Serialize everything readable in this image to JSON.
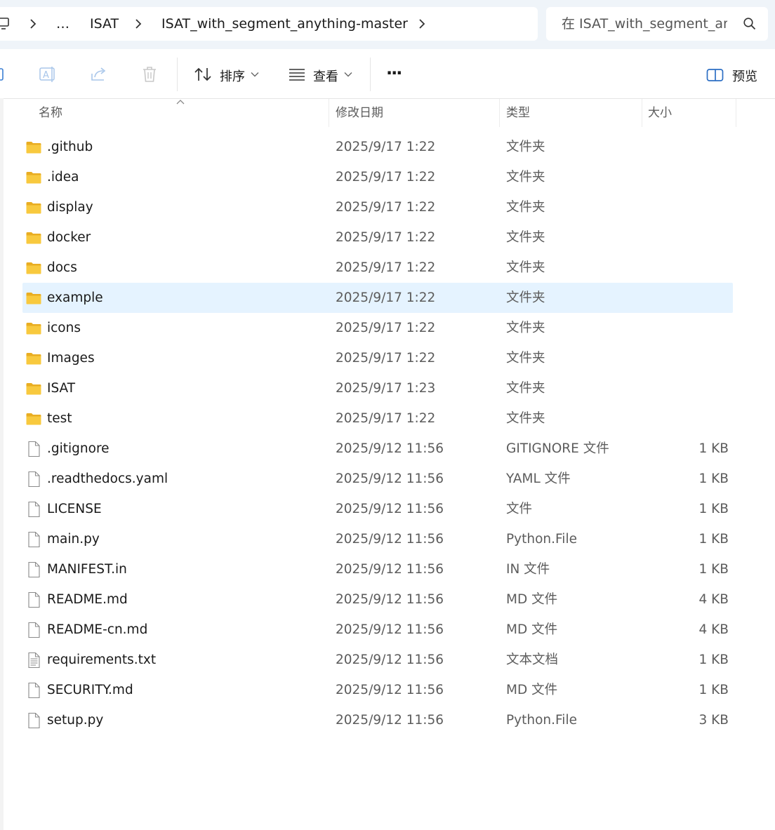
{
  "address_bar": {
    "items": [
      "…",
      "ISAT",
      "ISAT_with_segment_anything-master"
    ]
  },
  "search": {
    "placeholder": "在 ISAT_with_segment_anything-master 中搜索"
  },
  "toolbar": {
    "sort_label": "排序",
    "view_label": "查看",
    "more_label": "···",
    "preview_label": "预览"
  },
  "columns": {
    "name": "名称",
    "date": "修改日期",
    "type": "类型",
    "size": "大小"
  },
  "files": [
    {
      "name": ".github",
      "date": "2025/9/17 1:22",
      "type": "文件夹",
      "size": "",
      "kind": "folder"
    },
    {
      "name": ".idea",
      "date": "2025/9/17 1:22",
      "type": "文件夹",
      "size": "",
      "kind": "folder"
    },
    {
      "name": "display",
      "date": "2025/9/17 1:22",
      "type": "文件夹",
      "size": "",
      "kind": "folder"
    },
    {
      "name": "docker",
      "date": "2025/9/17 1:22",
      "type": "文件夹",
      "size": "",
      "kind": "folder"
    },
    {
      "name": "docs",
      "date": "2025/9/17 1:22",
      "type": "文件夹",
      "size": "",
      "kind": "folder"
    },
    {
      "name": "example",
      "date": "2025/9/17 1:22",
      "type": "文件夹",
      "size": "",
      "kind": "folder",
      "selected": true
    },
    {
      "name": "icons",
      "date": "2025/9/17 1:22",
      "type": "文件夹",
      "size": "",
      "kind": "folder"
    },
    {
      "name": "Images",
      "date": "2025/9/17 1:22",
      "type": "文件夹",
      "size": "",
      "kind": "folder"
    },
    {
      "name": "ISAT",
      "date": "2025/9/17 1:23",
      "type": "文件夹",
      "size": "",
      "kind": "folder"
    },
    {
      "name": "test",
      "date": "2025/9/17 1:22",
      "type": "文件夹",
      "size": "",
      "kind": "folder"
    },
    {
      "name": ".gitignore",
      "date": "2025/9/12 11:56",
      "type": "GITIGNORE 文件",
      "size": "1 KB",
      "kind": "file"
    },
    {
      "name": ".readthedocs.yaml",
      "date": "2025/9/12 11:56",
      "type": "YAML 文件",
      "size": "1 KB",
      "kind": "file"
    },
    {
      "name": "LICENSE",
      "date": "2025/9/12 11:56",
      "type": "文件",
      "size": "1 KB",
      "kind": "file"
    },
    {
      "name": "main.py",
      "date": "2025/9/12 11:56",
      "type": "Python.File",
      "size": "1 KB",
      "kind": "file"
    },
    {
      "name": "MANIFEST.in",
      "date": "2025/9/12 11:56",
      "type": "IN 文件",
      "size": "1 KB",
      "kind": "file"
    },
    {
      "name": "README.md",
      "date": "2025/9/12 11:56",
      "type": "MD 文件",
      "size": "4 KB",
      "kind": "file"
    },
    {
      "name": "README-cn.md",
      "date": "2025/9/12 11:56",
      "type": "MD 文件",
      "size": "4 KB",
      "kind": "file"
    },
    {
      "name": "requirements.txt",
      "date": "2025/9/12 11:56",
      "type": "文本文档",
      "size": "1 KB",
      "kind": "text"
    },
    {
      "name": "SECURITY.md",
      "date": "2025/9/12 11:56",
      "type": "MD 文件",
      "size": "1 KB",
      "kind": "file"
    },
    {
      "name": "setup.py",
      "date": "2025/9/12 11:56",
      "type": "Python.File",
      "size": "3 KB",
      "kind": "file"
    }
  ],
  "colors": {
    "selection": "#e5f3ff",
    "folder": "#f8c93e",
    "address_bg": "#eff4f9"
  }
}
